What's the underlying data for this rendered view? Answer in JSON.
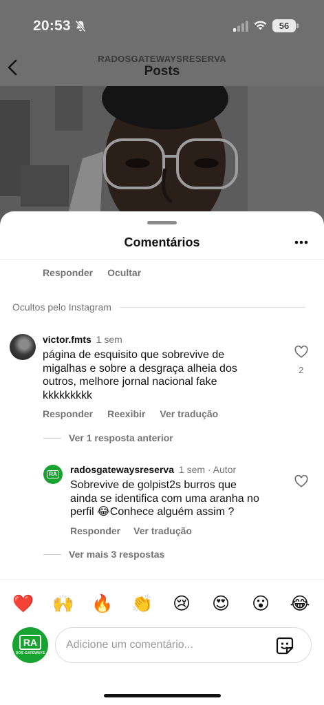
{
  "status_bar": {
    "time": "20:53",
    "battery": "56"
  },
  "header": {
    "username": "RADOSGATEWAYSRESERVA",
    "title": "Posts"
  },
  "sheet": {
    "title": "Comentários",
    "top_actions": {
      "reply": "Responder",
      "hide": "Ocultar"
    },
    "hidden_label": "Ocultos pelo Instagram"
  },
  "comment": {
    "username": "victor.fmts",
    "age": "1 sem",
    "text_lines": [
      "página de esquisito que sobrevive de",
      "migalhas e sobre a desgraça alheia dos",
      "outros, melhore jornal nacional fake",
      "kkkkkkkkk"
    ],
    "likes": "2",
    "reply": "Responder",
    "show": "Reexibir",
    "translate": "Ver tradução",
    "previous_replies": "Ver 1 resposta anterior"
  },
  "reply": {
    "username": "radosgatewaysreserva",
    "meta": "1 sem · Autor",
    "text_lines": [
      "Sobrevive de golpist2s burros que",
      "ainda se identifica com uma aranha no",
      "perfil 😂Conhece alguém assim ?"
    ],
    "reply": "Responder",
    "translate": "Ver tradução",
    "more_replies": "Ver mais 3 respostas"
  },
  "logo_text": {
    "initials": "RA",
    "caption": "DOS GATEWAYS"
  },
  "emoji_bar": [
    "❤️",
    "🙌",
    "🔥",
    "👏",
    "😢",
    "😍",
    "😮",
    "😂"
  ],
  "composer": {
    "placeholder": "Adicione um comentário..."
  },
  "colors": {
    "accent_green": "#17a32f",
    "secondary_text": "#737373",
    "heart_red": "#ed1c2e"
  }
}
